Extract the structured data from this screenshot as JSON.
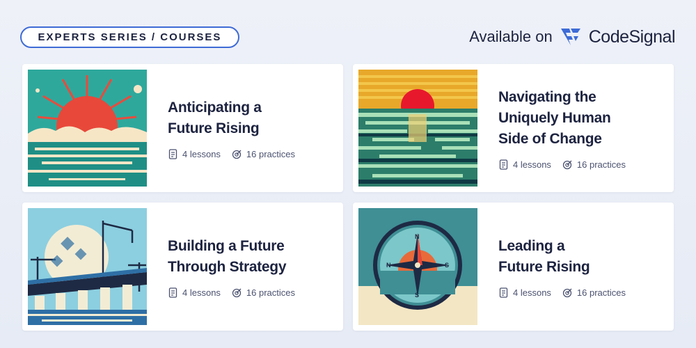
{
  "header": {
    "series_label": "EXPERTS SERIES / COURSES",
    "available_text": "Available on",
    "brand_name": "CodeSignal"
  },
  "colors": {
    "accent": "#3e6bd6",
    "text": "#1d2340",
    "background": "#eef1f8"
  },
  "courses": [
    {
      "title_line1": "Anticipating a",
      "title_line2": "Future Rising",
      "title_line3": "",
      "lessons": "4 lessons",
      "practices": "16 practices",
      "thumbnail_icon": "sun-over-sea-illustration"
    },
    {
      "title_line1": "Navigating the",
      "title_line2": "Uniquely Human",
      "title_line3": "Side of Change",
      "lessons": "4 lessons",
      "practices": "16 practices",
      "thumbnail_icon": "sunset-waves-illustration"
    },
    {
      "title_line1": "Building a Future",
      "title_line2": "Through Strategy",
      "title_line3": "",
      "lessons": "4 lessons",
      "practices": "16 practices",
      "thumbnail_icon": "bridge-construction-illustration"
    },
    {
      "title_line1": "Leading a",
      "title_line2": "Future Rising",
      "title_line3": "",
      "lessons": "4 lessons",
      "practices": "16 practices",
      "thumbnail_icon": "compass-illustration"
    }
  ]
}
